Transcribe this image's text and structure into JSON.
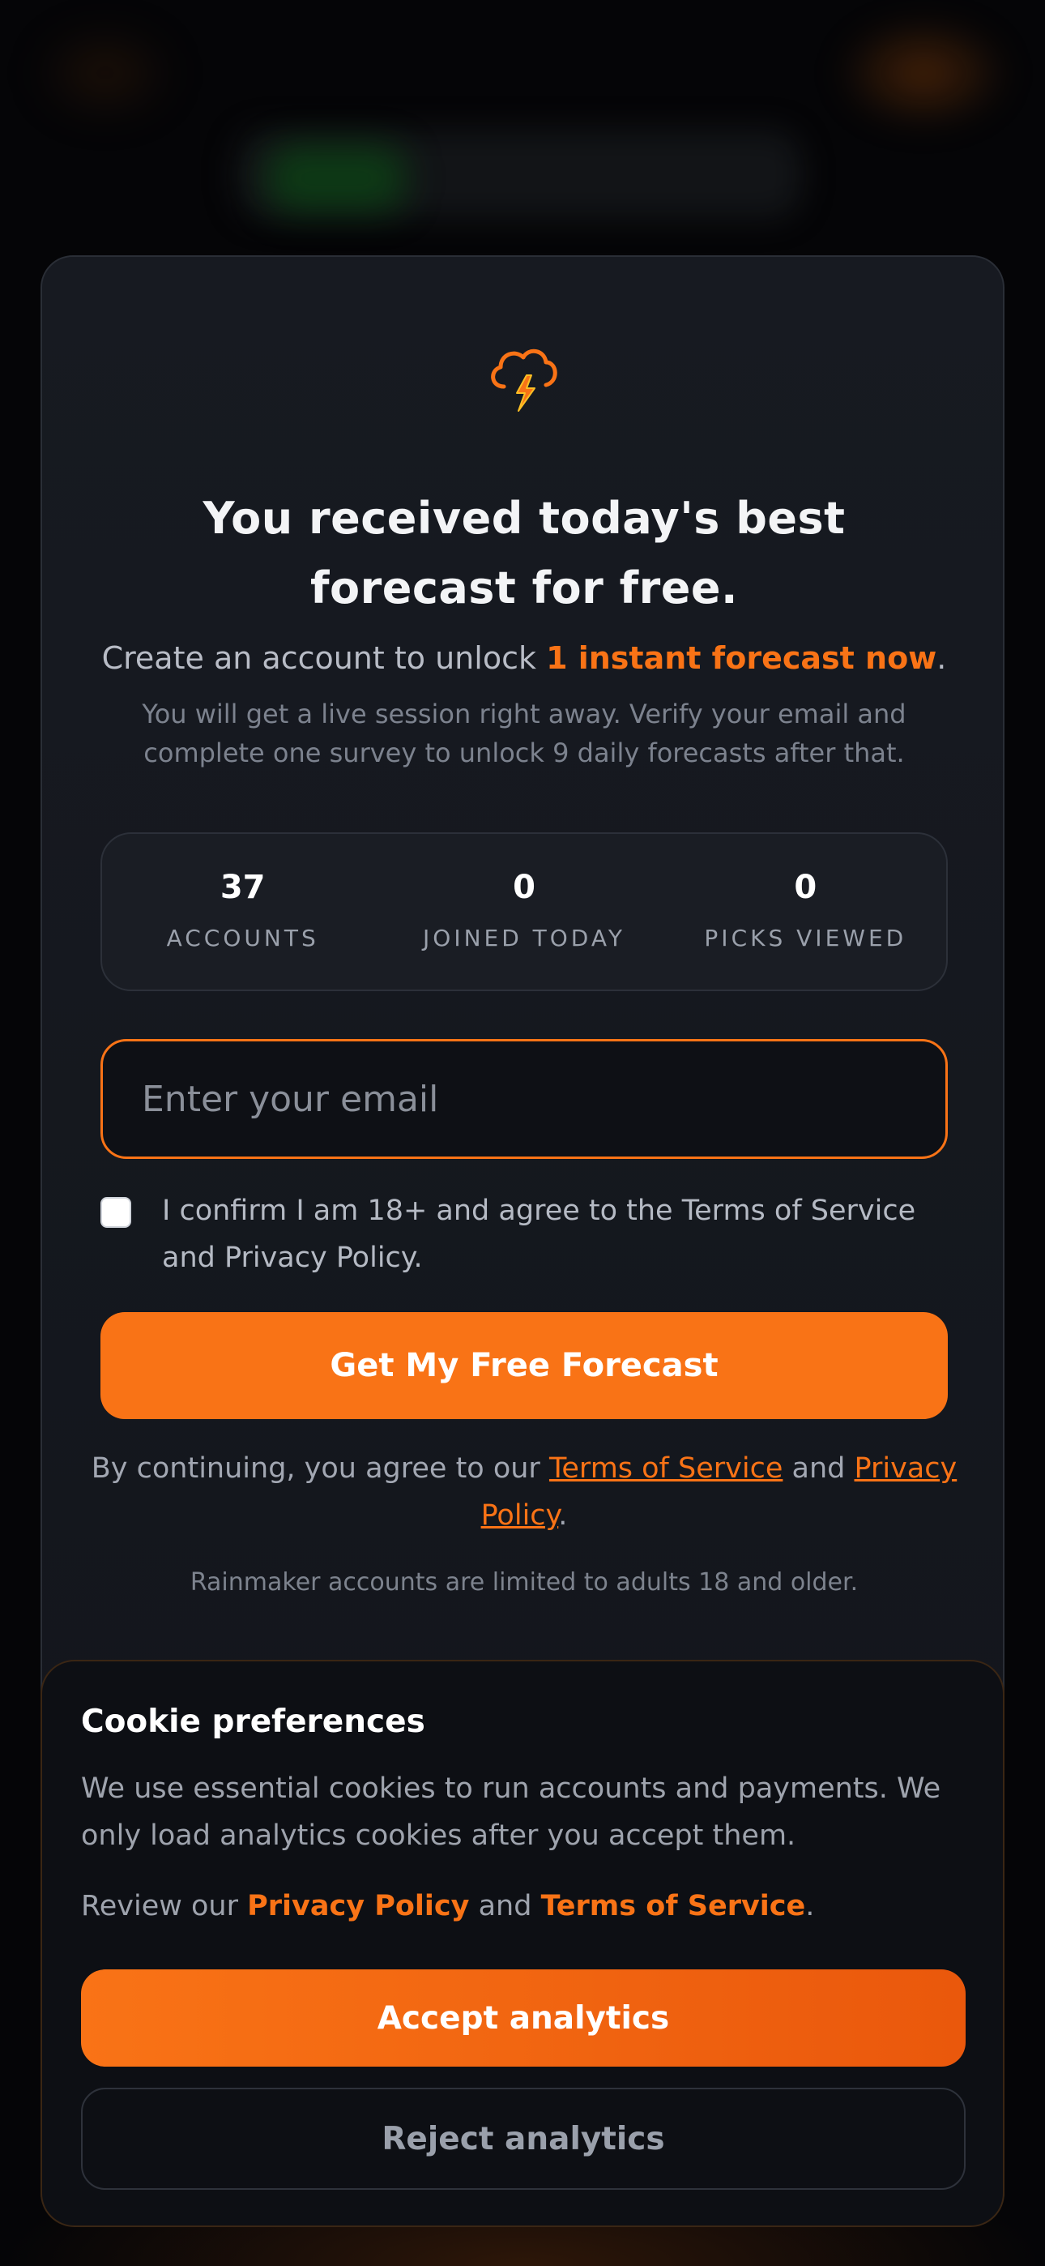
{
  "hero": {
    "headline": "You received today's best forecast for free.",
    "subline_prefix": "Create an account to unlock ",
    "subline_accent": "1 instant forecast now",
    "subline_suffix": ".",
    "note": "You will get a live session right away. Verify your email and complete one survey to unlock 9 daily forecasts after that."
  },
  "stats": [
    {
      "value": "37",
      "label": "ACCOUNTS"
    },
    {
      "value": "0",
      "label": "JOINED TODAY"
    },
    {
      "value": "0",
      "label": "PICKS VIEWED"
    }
  ],
  "form": {
    "email_placeholder": "Enter your email",
    "email_value": "",
    "consent_checked": false,
    "consent_text": "I confirm I am 18+ and agree to the Terms of Service and Privacy Policy.",
    "submit_label": "Get My Free Forecast"
  },
  "legal": {
    "prefix": "By continuing, you agree to our ",
    "terms_link": "Terms of Service",
    "and": " and ",
    "privacy_link": "Privacy Policy",
    "suffix": "."
  },
  "age_note": "Rainmaker accounts are limited to adults 18 and older.",
  "cookie": {
    "title": "Cookie preferences",
    "body": "We use essential cookies to run accounts and payments. We only load analytics cookies after you accept them.",
    "review_prefix": "Review our ",
    "privacy_link": "Privacy Policy",
    "and": " and ",
    "terms_link": "Terms of Service",
    "suffix": ".",
    "accept_label": "Accept analytics",
    "reject_label": "Reject analytics"
  },
  "colors": {
    "accent": "#f97316",
    "card_bg": "#171a21",
    "page_bg": "#050507"
  },
  "icons": {
    "logo": "storm-cloud-lightning-icon"
  }
}
